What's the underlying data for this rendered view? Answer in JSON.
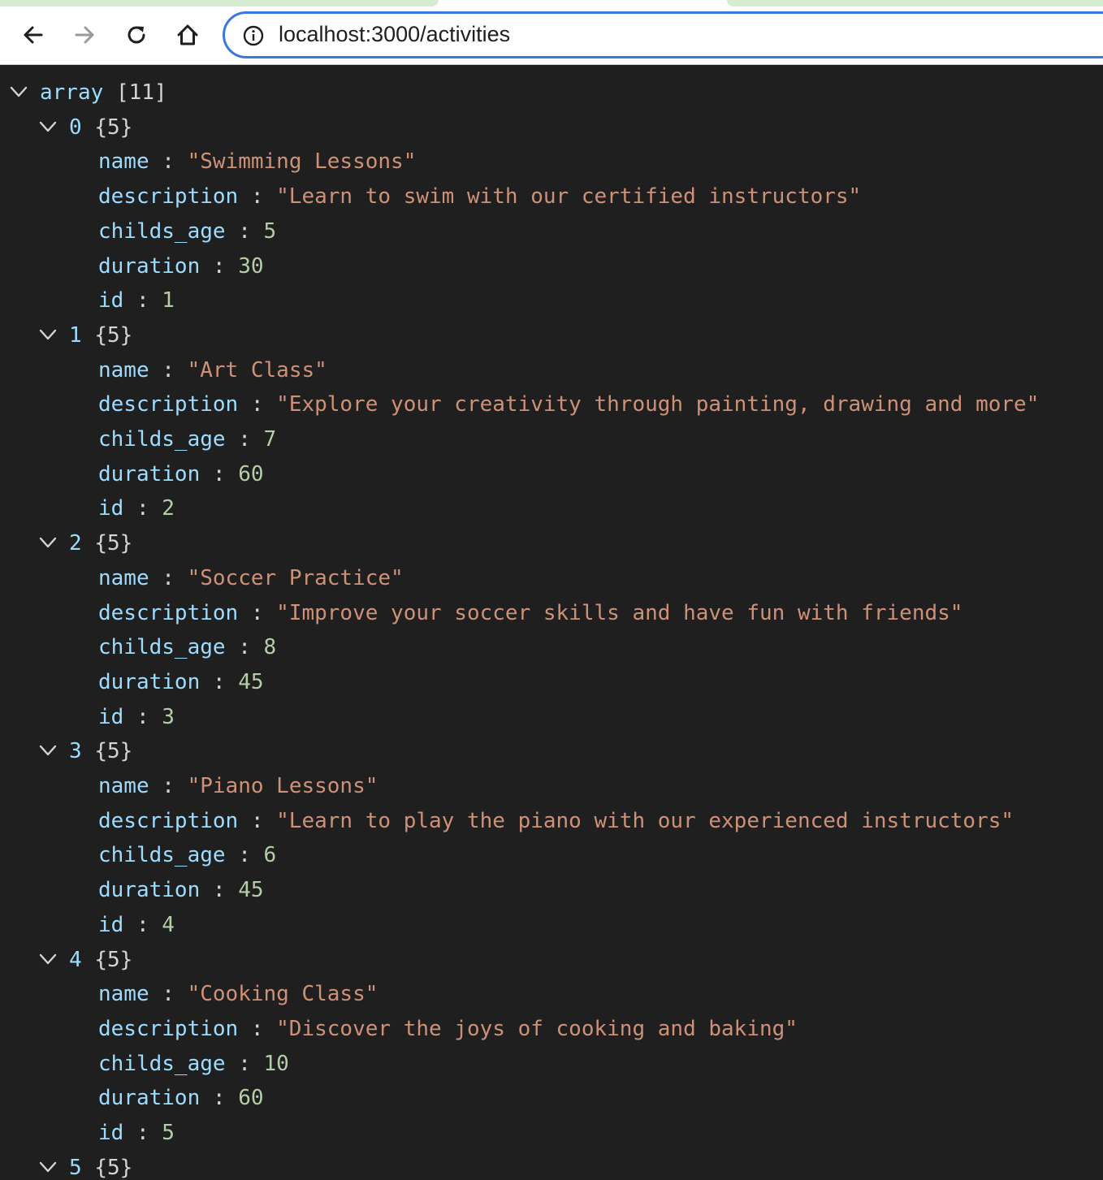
{
  "browser": {
    "url": "localhost:3000/activities"
  },
  "viewer": {
    "root": {
      "key": "array",
      "count": "[11]"
    },
    "items": [
      {
        "index": "0",
        "count": "{5}",
        "fields": [
          {
            "key": "name",
            "value": "\"Swimming Lessons\"",
            "type": "string"
          },
          {
            "key": "description",
            "value": "\"Learn to swim with our certified instructors\"",
            "type": "string"
          },
          {
            "key": "childs_age",
            "value": "5",
            "type": "number"
          },
          {
            "key": "duration",
            "value": "30",
            "type": "number"
          },
          {
            "key": "id",
            "value": "1",
            "type": "number"
          }
        ]
      },
      {
        "index": "1",
        "count": "{5}",
        "fields": [
          {
            "key": "name",
            "value": "\"Art Class\"",
            "type": "string"
          },
          {
            "key": "description",
            "value": "\"Explore your creativity through painting, drawing and more\"",
            "type": "string"
          },
          {
            "key": "childs_age",
            "value": "7",
            "type": "number"
          },
          {
            "key": "duration",
            "value": "60",
            "type": "number"
          },
          {
            "key": "id",
            "value": "2",
            "type": "number"
          }
        ]
      },
      {
        "index": "2",
        "count": "{5}",
        "fields": [
          {
            "key": "name",
            "value": "\"Soccer Practice\"",
            "type": "string"
          },
          {
            "key": "description",
            "value": "\"Improve your soccer skills and have fun with friends\"",
            "type": "string"
          },
          {
            "key": "childs_age",
            "value": "8",
            "type": "number"
          },
          {
            "key": "duration",
            "value": "45",
            "type": "number"
          },
          {
            "key": "id",
            "value": "3",
            "type": "number"
          }
        ]
      },
      {
        "index": "3",
        "count": "{5}",
        "fields": [
          {
            "key": "name",
            "value": "\"Piano Lessons\"",
            "type": "string"
          },
          {
            "key": "description",
            "value": "\"Learn to play the piano with our experienced instructors\"",
            "type": "string"
          },
          {
            "key": "childs_age",
            "value": "6",
            "type": "number"
          },
          {
            "key": "duration",
            "value": "45",
            "type": "number"
          },
          {
            "key": "id",
            "value": "4",
            "type": "number"
          }
        ]
      },
      {
        "index": "4",
        "count": "{5}",
        "fields": [
          {
            "key": "name",
            "value": "\"Cooking Class\"",
            "type": "string"
          },
          {
            "key": "description",
            "value": "\"Discover the joys of cooking and baking\"",
            "type": "string"
          },
          {
            "key": "childs_age",
            "value": "10",
            "type": "number"
          },
          {
            "key": "duration",
            "value": "60",
            "type": "number"
          },
          {
            "key": "id",
            "value": "5",
            "type": "number"
          }
        ]
      },
      {
        "index": "5",
        "count": "{5}",
        "fields": []
      }
    ],
    "separator": ":"
  }
}
